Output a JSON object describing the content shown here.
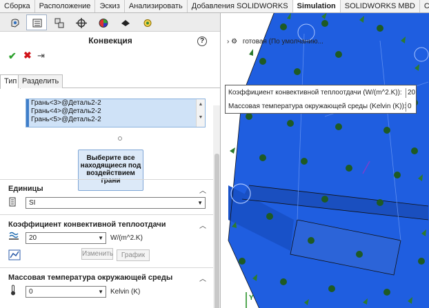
{
  "ribbon": {
    "tabs": [
      "Сборка",
      "Расположение",
      "Эскиз",
      "Анализировать",
      "Добавления SOLIDWORKS",
      "Simulation",
      "SOLIDWORKS MBD",
      "CircuitW"
    ],
    "active": "Simulation"
  },
  "panel": {
    "title": "Конвекция",
    "help": "?",
    "ok": "✔",
    "cancel": "✖",
    "pin": "⇥",
    "subtabs": [
      "Тип",
      "Разделить"
    ],
    "faces": [
      "Грань<3>@Деталь2-2",
      "Грань<4>@Деталь2-2",
      "Грань<5>@Деталь2-2"
    ],
    "select_button": "Выберите все находящиеся под воздействием грани",
    "units": {
      "title": "Единицы",
      "value": "SI"
    },
    "conv": {
      "title": "Коэффициент конвективной теплоотдачи",
      "value": "20",
      "unit": "W/(m^2.K)",
      "edit_btn": "Изменить",
      "graph_btn": "График"
    },
    "temp": {
      "title": "Массовая температура окружающей среды",
      "value": "0",
      "unit": "Kelvin (K)"
    }
  },
  "graphics": {
    "tree_label": "готовая (По умолчанию...",
    "tooltip": {
      "conv_label": "Коэффициент конвективной теплоотдачи (W/(m^2.K)):",
      "conv_value": "20",
      "temp_label": "Массовая температура окружающей среды (Kelvin (K)):",
      "temp_value": "0"
    },
    "axis_y": "Y",
    "colors": {
      "part": "#1f5ee0",
      "arrow": "#1e5a24"
    }
  }
}
